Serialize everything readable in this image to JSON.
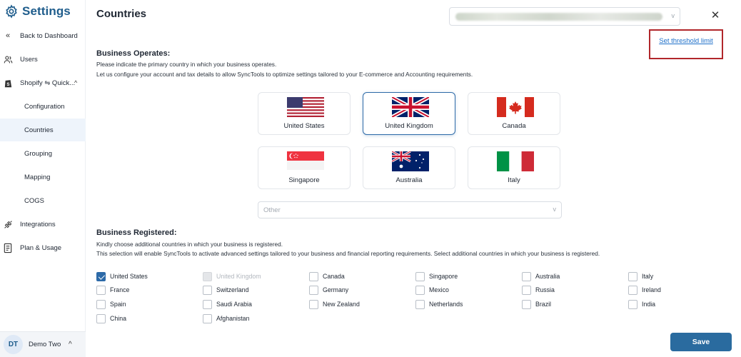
{
  "sidebar": {
    "brand": "Settings",
    "back_label": "Back to Dashboard",
    "items": [
      {
        "label": "Users",
        "icon": "users-icon"
      },
      {
        "label": "Shopify ⇋ Quick...",
        "icon": "shopify-icon",
        "expanded": true
      },
      {
        "label": "Configuration"
      },
      {
        "label": "Countries",
        "active": true
      },
      {
        "label": "Grouping"
      },
      {
        "label": "Mapping"
      },
      {
        "label": "COGS"
      },
      {
        "label": "Integrations",
        "icon": "integrations-icon"
      },
      {
        "label": "Plan & Usage",
        "icon": "plan-icon"
      }
    ],
    "user": {
      "initials": "DT",
      "name": "Demo Two"
    }
  },
  "header": {
    "title": "Countries",
    "close_icon": "close-icon"
  },
  "threshold_link": "Set threshold limit",
  "operates": {
    "heading": "Business Operates:",
    "line1": "Please indicate the primary country in which your business operates.",
    "line2": "Let us configure your account and tax details to allow SyncTools to optimize settings tailored to your E-commerce and Accounting requirements.",
    "cards": [
      {
        "name": "United States",
        "selected": false
      },
      {
        "name": "United Kingdom",
        "selected": true
      },
      {
        "name": "Canada",
        "selected": false
      },
      {
        "name": "Singapore",
        "selected": false
      },
      {
        "name": "Australia",
        "selected": false
      },
      {
        "name": "Italy",
        "selected": false
      }
    ],
    "other_placeholder": "Other"
  },
  "registered": {
    "heading": "Business Registered:",
    "line1": "Kindly choose additional countries in which your business is registered.",
    "line2": "This selection will enable SyncTools to activate advanced settings tailored to your business and financial reporting requirements. Select additional countries in which your business is registered.",
    "countries": [
      {
        "name": "United States",
        "checked": true,
        "disabled": false
      },
      {
        "name": "United Kingdom",
        "checked": false,
        "disabled": true
      },
      {
        "name": "Canada",
        "checked": false,
        "disabled": false
      },
      {
        "name": "Singapore",
        "checked": false,
        "disabled": false
      },
      {
        "name": "Australia",
        "checked": false,
        "disabled": false
      },
      {
        "name": "Italy",
        "checked": false,
        "disabled": false
      },
      {
        "name": "France",
        "checked": false,
        "disabled": false
      },
      {
        "name": "Switzerland",
        "checked": false,
        "disabled": false
      },
      {
        "name": "Germany",
        "checked": false,
        "disabled": false
      },
      {
        "name": "Mexico",
        "checked": false,
        "disabled": false
      },
      {
        "name": "Russia",
        "checked": false,
        "disabled": false
      },
      {
        "name": "Ireland",
        "checked": false,
        "disabled": false
      },
      {
        "name": "Spain",
        "checked": false,
        "disabled": false
      },
      {
        "name": "Saudi Arabia",
        "checked": false,
        "disabled": false
      },
      {
        "name": "New Zealand",
        "checked": false,
        "disabled": false
      },
      {
        "name": "Netherlands",
        "checked": false,
        "disabled": false
      },
      {
        "name": "Brazil",
        "checked": false,
        "disabled": false
      },
      {
        "name": "India",
        "checked": false,
        "disabled": false
      },
      {
        "name": "China",
        "checked": false,
        "disabled": false
      },
      {
        "name": "Afghanistan",
        "checked": false,
        "disabled": false
      }
    ]
  },
  "save_label": "Save",
  "colors": {
    "brand": "#1f5d8c",
    "accent": "#2a6b9f",
    "highlight": "#b1272b",
    "link": "#1d6fc9"
  }
}
